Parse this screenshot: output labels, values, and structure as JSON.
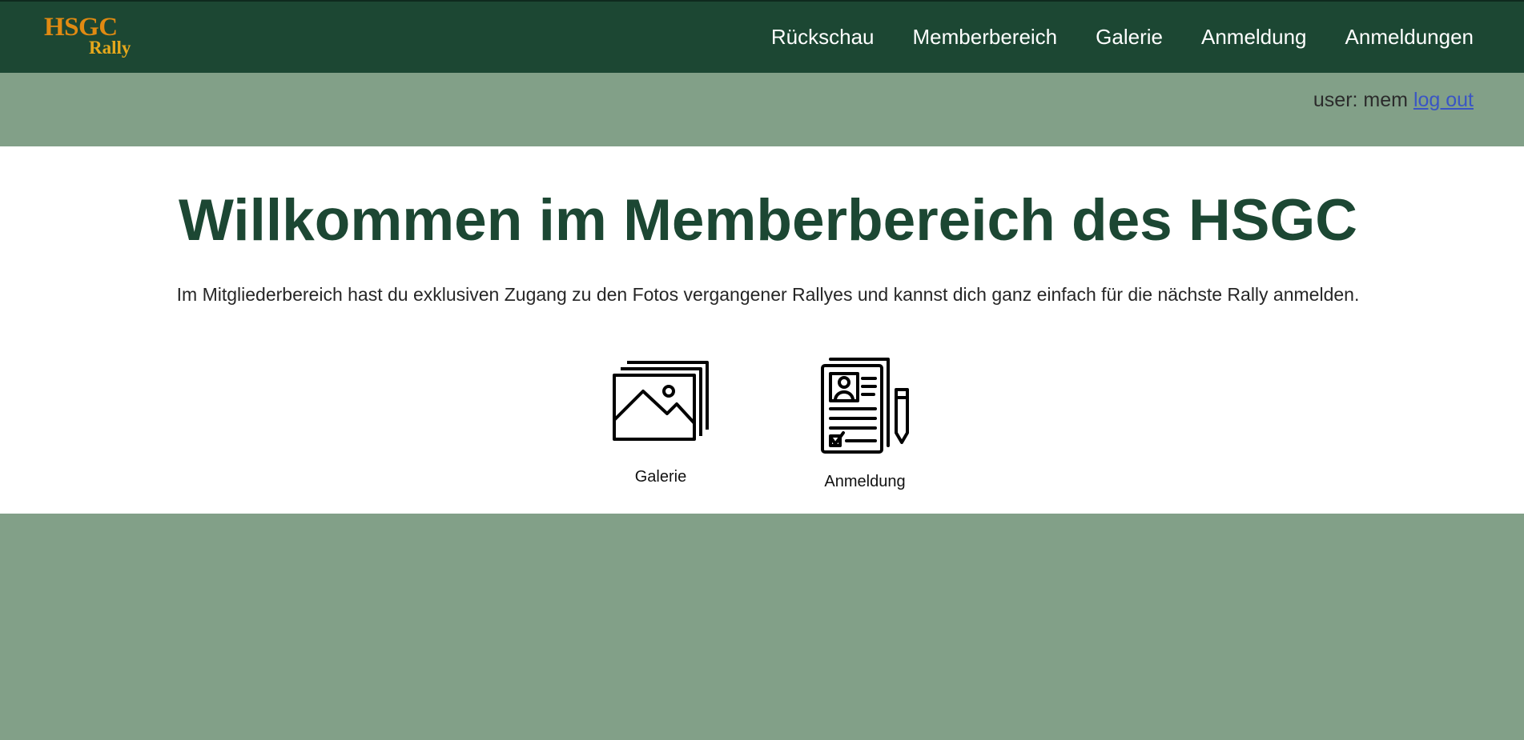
{
  "header": {
    "logo_main": "HSGC",
    "logo_sub": "Rally",
    "nav": [
      {
        "label": "Rückschau"
      },
      {
        "label": "Memberbereich"
      },
      {
        "label": "Galerie"
      },
      {
        "label": "Anmeldung"
      },
      {
        "label": "Anmeldungen"
      }
    ]
  },
  "user": {
    "prefix": "user: mem",
    "logout_label": "log out"
  },
  "main": {
    "title": "Willkommen im Memberbereich des HSGC",
    "description": "Im Mitgliederbereich hast du exklusiven Zugang zu den Fotos vergangener Rallyes und kannst dich ganz einfach für die nächste Rally anmelden.",
    "tiles": [
      {
        "label": "Galerie",
        "icon": "gallery-icon"
      },
      {
        "label": "Anmeldung",
        "icon": "registration-form-icon"
      }
    ]
  },
  "colors": {
    "header_bg": "#1c4733",
    "page_bg": "#82a088",
    "logo_orange": "#e08a12",
    "link_blue": "#3a55c4"
  }
}
